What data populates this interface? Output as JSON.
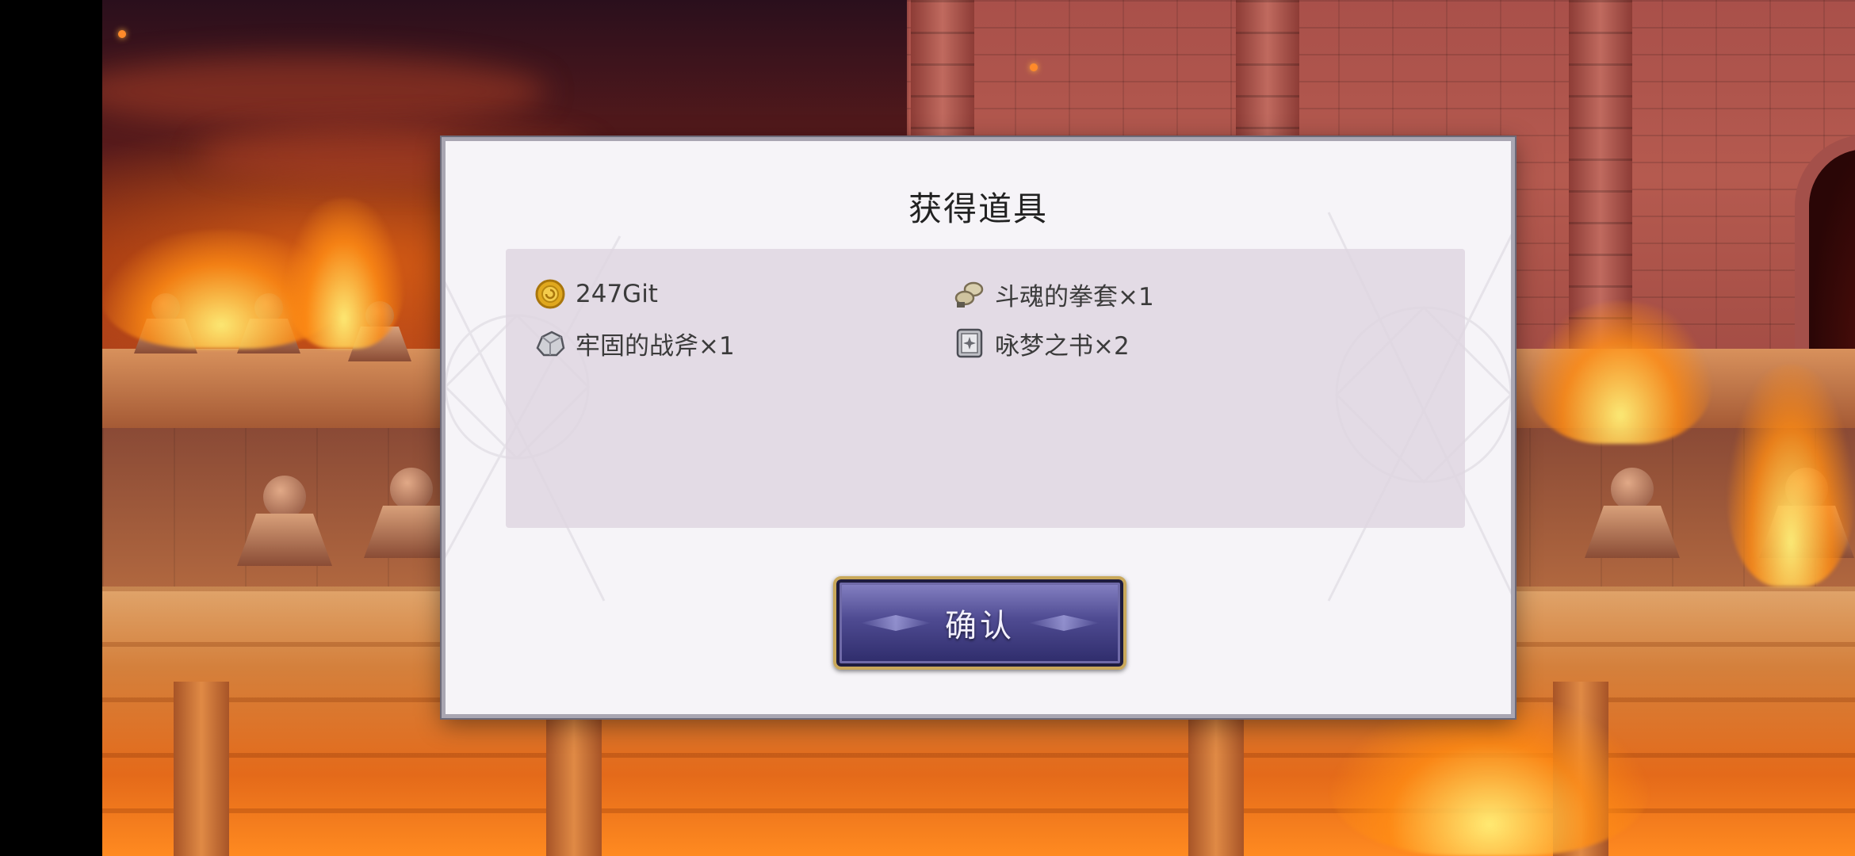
{
  "dialog": {
    "title": "获得道具",
    "confirm_label": "确认"
  },
  "items": [
    {
      "icon": "gold-coin-icon",
      "label": "247Git"
    },
    {
      "icon": "fist-gauntlet-icon",
      "label": "斗魂的拳套×1"
    },
    {
      "icon": "ore-stone-icon",
      "label": "牢固的战斧×1"
    },
    {
      "icon": "book-icon",
      "label": "咏梦之书×2"
    }
  ],
  "colors": {
    "dialog_bg": "#f6f4f8",
    "panel_bg": "#ded6e0",
    "button_purple": "#4f4b92",
    "button_gold": "#c9a85a"
  }
}
